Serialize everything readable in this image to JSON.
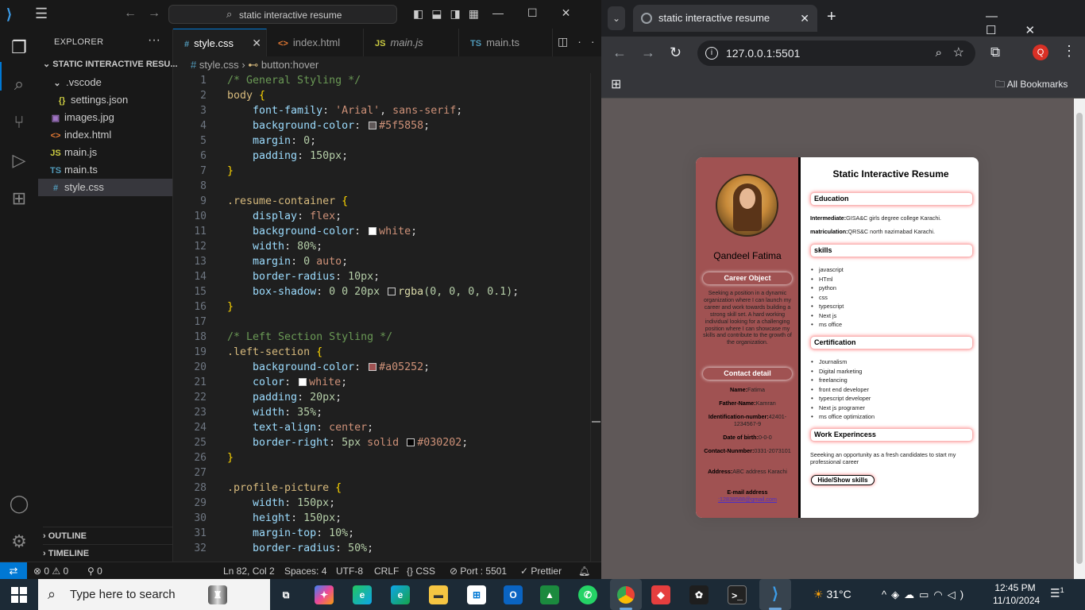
{
  "vscode": {
    "search_text": "static interactive resume",
    "explorer_title": "EXPLORER",
    "project_name": "STATIC INTERACTIVE RESU...",
    "tree": [
      {
        "label": ".vscode",
        "icon": "chevron-down-icon"
      },
      {
        "label": "settings.json",
        "icon": "json-file-icon"
      },
      {
        "label": "images.jpg",
        "icon": "image-file-icon"
      },
      {
        "label": "index.html",
        "icon": "html-file-icon"
      },
      {
        "label": "main.js",
        "icon": "js-file-icon"
      },
      {
        "label": "main.ts",
        "icon": "ts-file-icon"
      },
      {
        "label": "style.css",
        "icon": "css-file-icon"
      }
    ],
    "outline_label": "OUTLINE",
    "timeline_label": "TIMELINE",
    "tabs": [
      {
        "label": "style.css",
        "icon_text": "#"
      },
      {
        "label": "index.html",
        "icon_text": "<>"
      },
      {
        "label": "main.js",
        "icon_text": "JS"
      },
      {
        "label": "main.ts",
        "icon_text": "TS"
      }
    ],
    "breadcrumb": {
      "file": "style.css",
      "symbol": "button:hover"
    },
    "status": {
      "problems": "⊗ 0 ⚠ 0",
      "ports": "⚲ 0",
      "position": "Ln 82, Col 2",
      "spaces": "Spaces: 4",
      "encoding": "UTF-8",
      "eol": "CRLF",
      "language": "CSS",
      "port": "Port : 5501",
      "prettier": "Prettier"
    }
  },
  "code_lines": [
    "1",
    "2",
    "3",
    "4",
    "5",
    "6",
    "7",
    "8",
    "9",
    "10",
    "11",
    "12",
    "13",
    "14",
    "15",
    "16",
    "17",
    "18",
    "19",
    "20",
    "21",
    "22",
    "23",
    "24",
    "25",
    "26",
    "27",
    "28",
    "29",
    "30",
    "31",
    "32"
  ],
  "code_text": {
    "l1": "/* General Styling */",
    "l2a": "body",
    "l2b": " {",
    "l3a": "    font-family",
    "l3b": ": ",
    "l3c": "'Arial'",
    "l3d": ", ",
    "l3e": "sans-serif",
    "l3f": ";",
    "l4a": "    background-color",
    "l4b": ": ",
    "l4c": "#5f5858",
    "l4d": ";",
    "l5a": "    margin",
    "l5b": ": ",
    "l5c": "0",
    "l5d": ";",
    "l6a": "    padding",
    "l6b": ": ",
    "l6c": "150px",
    "l6d": ";",
    "l7": "}",
    "l9a": ".resume-container",
    "l9b": " {",
    "l10a": "    display",
    "l10b": ": ",
    "l10c": "flex",
    "l10d": ";",
    "l11a": "    background-color",
    "l11b": ": ",
    "l11c": "white",
    "l11d": ";",
    "l12a": "    width",
    "l12b": ": ",
    "l12c": "80%",
    "l12d": ";",
    "l13a": "    margin",
    "l13b": ": ",
    "l13c": "0",
    "l13d": " ",
    "l13e": "auto",
    "l13f": ";",
    "l14a": "    border-radius",
    "l14b": ": ",
    "l14c": "10px",
    "l14d": ";",
    "l15a": "    box-shadow",
    "l15b": ": ",
    "l15c": "0 0 20px",
    "l15d": " ",
    "l15e": "rgba",
    "l15f": "(0, 0, 0, 0.1)",
    "l15g": ";",
    "l16": "}",
    "l18": "/* Left Section Styling */",
    "l19a": ".left-section",
    "l19b": " {",
    "l20a": "    background-color",
    "l20b": ": ",
    "l20c": "#a05252",
    "l20d": ";",
    "l21a": "    color",
    "l21b": ": ",
    "l21c": "white",
    "l21d": ";",
    "l22a": "    padding",
    "l22b": ": ",
    "l22c": "20px",
    "l22d": ";",
    "l23a": "    width",
    "l23b": ": ",
    "l23c": "35%",
    "l23d": ";",
    "l24a": "    text-align",
    "l24b": ": ",
    "l24c": "center",
    "l24d": ";",
    "l25a": "    border-right",
    "l25b": ": ",
    "l25c": "5px",
    "l25d": " solid ",
    "l25e": "#030202",
    "l25f": ";",
    "l26": "}",
    "l28a": ".profile-picture",
    "l28b": " {",
    "l29a": "    width",
    "l29b": ": ",
    "l29c": "150px",
    "l29d": ";",
    "l30a": "    height",
    "l30b": ": ",
    "l30c": "150px",
    "l30d": ";",
    "l31a": "    margin-top",
    "l31b": ": ",
    "l31c": "10%",
    "l31d": ";",
    "l32a": "    border-radius",
    "l32b": ": ",
    "l32c": "50%",
    "l32d": ";"
  },
  "swatch_colors": {
    "c5f5858": "#5f5858",
    "white": "#ffffff",
    "shadow": "#202020",
    "ca05252": "#a05252",
    "c030202": "#030202"
  },
  "browser": {
    "tab_title": "static interactive resume",
    "url": "127.0.0.1:5501",
    "avatar_letter": "Q",
    "bookmarks_label": "All Bookmarks"
  },
  "resume": {
    "title": "Static Interactive Resume",
    "name": "Qandeel Fatima",
    "career_label": "Career Object",
    "career_text": "Seeking a position in a dynamic organization where I can launch my career and work towards building a strong skill set. A hard working individual looking for a challenging position where I can showcase my skills and contribute to the growth of the organization.",
    "contact_label": "Contact detail",
    "contacts": [
      {
        "k": "Name:",
        "v": "Fatima"
      },
      {
        "k": "Father-Name:",
        "v": "Kamran"
      },
      {
        "k": "Identification-number:",
        "v": "42401-1234567-9"
      },
      {
        "k": "Date of birth:",
        "v": "0-0-0"
      },
      {
        "k": "Contact-Nunmber:",
        "v": "0331-2073101"
      },
      {
        "k": "Address:",
        "v": "ABC address Karachi"
      }
    ],
    "email_label": "E-mail address",
    "email_value": ":12838588@gmail.com",
    "education_label": "Education",
    "edu": [
      {
        "k": "Intermediate:",
        "v": "GISA&C girls degree college Karachi."
      },
      {
        "k": "matriculation:",
        "v": "QRS&C north nazimabad Karachi."
      }
    ],
    "skills_label": "skills",
    "skills": [
      "javascript",
      "HTml",
      "python",
      "css",
      "typescript",
      "Next js",
      "ms office"
    ],
    "cert_label": "Certification",
    "certs": [
      "Journalism",
      "Digital marketing",
      "freelancing",
      "front end developer",
      "typescript developer",
      "Next js programer",
      "ms office optimization"
    ],
    "work_label": "Work Experincess",
    "work_text": "Seeeking an opportunity as a fresh candidates to start my professional career",
    "toggle_button": "Hide/Show skills"
  },
  "taskbar": {
    "search_placeholder": "Type here to search",
    "temperature": "31°C",
    "time": "12:45 PM",
    "date": "11/10/2024",
    "notification_count": "1"
  }
}
